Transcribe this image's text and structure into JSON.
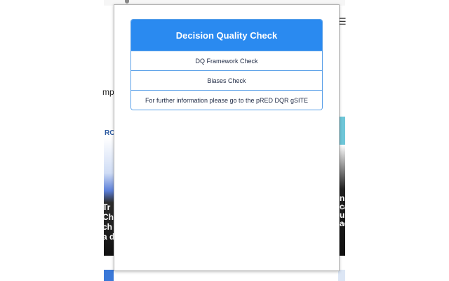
{
  "background": {
    "menu_icon": "☰",
    "left_fragment": "mp",
    "ro_fragment": "RO",
    "left_card_text": "Tr\nCh\nch\na d",
    "right_card_text": "n\nca\nu\nac"
  },
  "popup": {
    "title": "Decision Quality Check",
    "items": [
      {
        "label": "DQ Framework Check"
      },
      {
        "label": "Biases Check"
      },
      {
        "label": "For further information please go to the pRED DQR gSITE"
      }
    ]
  },
  "colors": {
    "header_bg": "#2a8af0",
    "border": "#5aa0e8",
    "item_text": "#1f2a44"
  }
}
